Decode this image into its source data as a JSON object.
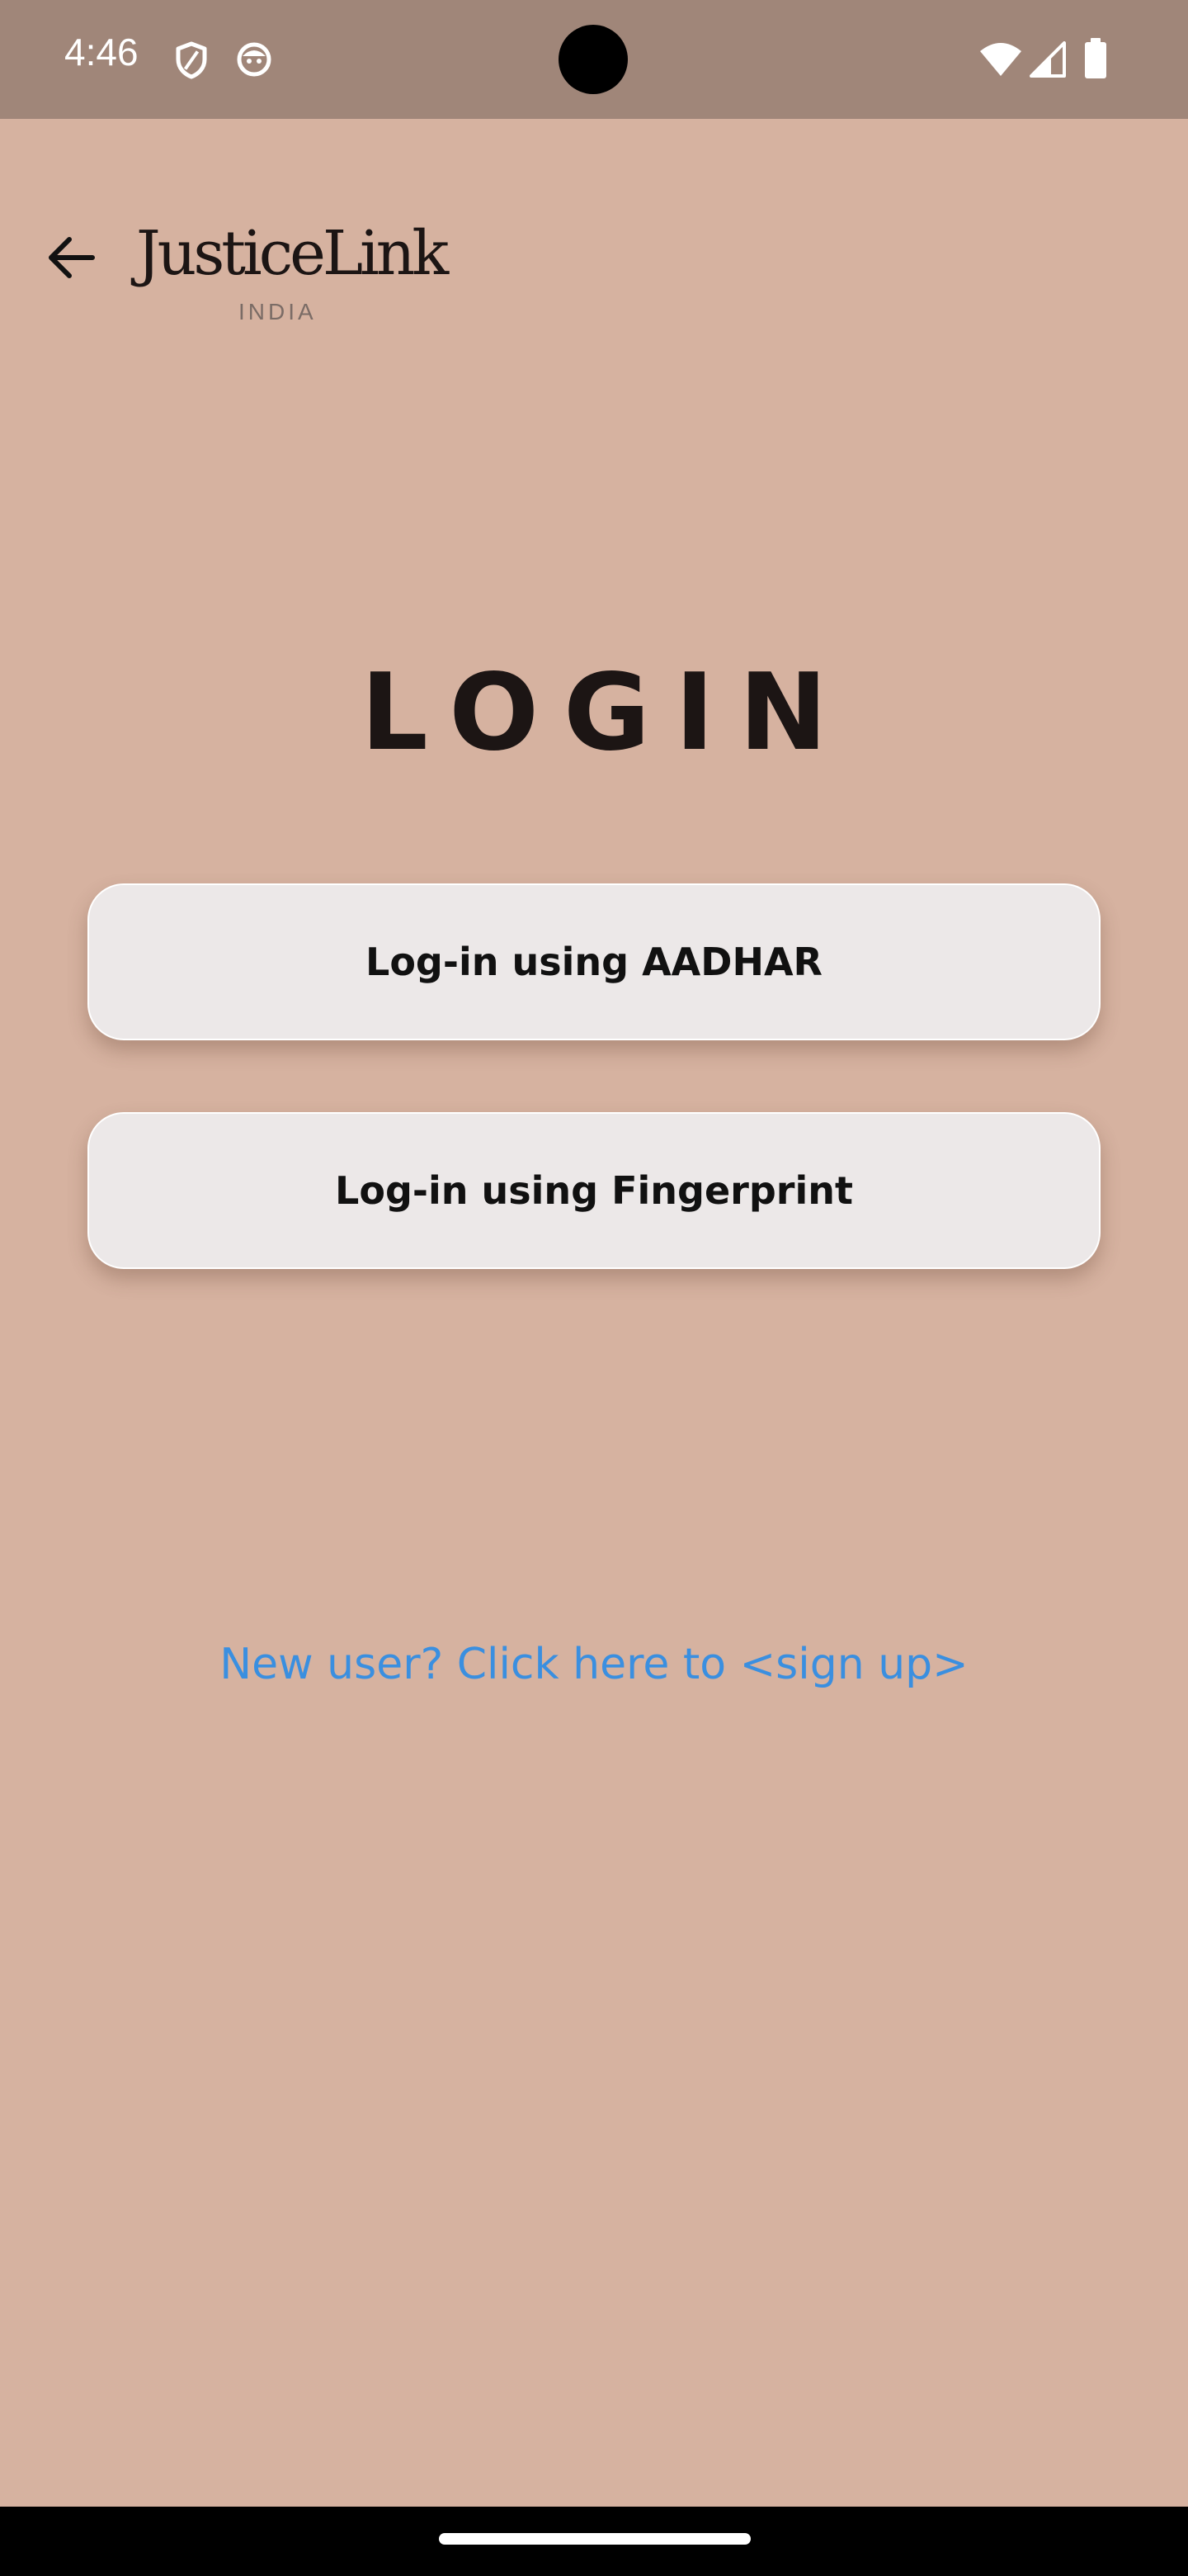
{
  "status_bar": {
    "time": "4:46",
    "icons": [
      "shield-icon",
      "face-icon",
      "wifi-icon",
      "signal-icon",
      "battery-icon"
    ]
  },
  "header": {
    "logo_name": "JusticeLink",
    "logo_sub": "INDIA"
  },
  "main": {
    "title": "LOGIN",
    "aadhar_button": "Log-in using AADHAR",
    "fingerprint_button": "Log-in using Fingerprint",
    "signup_link": "New user? Click here to <sign up>"
  },
  "colors": {
    "background": "#d6b2a0",
    "status_bar": "#a08679",
    "button_bg": "#ece8e8",
    "link": "#3a8fe0"
  }
}
